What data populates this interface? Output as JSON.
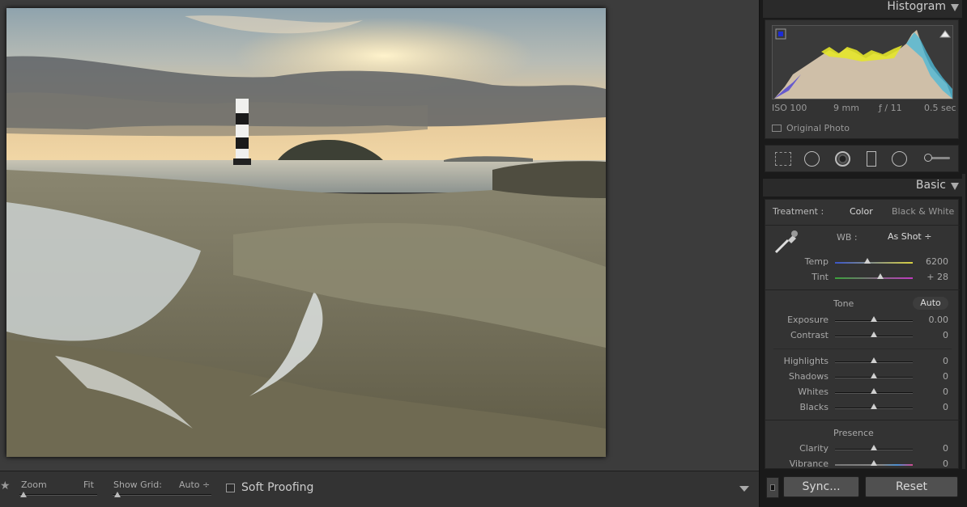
{
  "toolbar": {
    "zoom_label": "Zoom",
    "zoom_value": "Fit",
    "grid_label": "Show Grid:",
    "grid_value": "Auto ÷",
    "soft_proofing_label": "Soft Proofing"
  },
  "histogram": {
    "title": "Histogram",
    "iso": "ISO 100",
    "focal": "9 mm",
    "aperture": "ƒ / 11",
    "shutter": "0.5 sec",
    "original_photo_label": "Original Photo"
  },
  "tools": [
    "crop-overlay-icon",
    "spot-removal-icon",
    "red-eye-icon",
    "graduated-filter-icon",
    "radial-filter-icon",
    "adjustment-brush-icon"
  ],
  "basic": {
    "title": "Basic",
    "treatment_label": "Treatment :",
    "treatment_color": "Color",
    "treatment_bw": "Black & White",
    "wb_label": "WB :",
    "wb_value": "As Shot ÷",
    "temp": {
      "label": "Temp",
      "value": "6200",
      "pos": 0.42
    },
    "tint": {
      "label": "Tint",
      "value": "+ 28",
      "pos": 0.58
    },
    "tone_label": "Tone",
    "auto_label": "Auto",
    "exposure": {
      "label": "Exposure",
      "value": "0.00",
      "pos": 0.5
    },
    "contrast": {
      "label": "Contrast",
      "value": "0",
      "pos": 0.5
    },
    "highlights": {
      "label": "Highlights",
      "value": "0",
      "pos": 0.5
    },
    "shadows": {
      "label": "Shadows",
      "value": "0",
      "pos": 0.5
    },
    "whites": {
      "label": "Whites",
      "value": "0",
      "pos": 0.5
    },
    "blacks": {
      "label": "Blacks",
      "value": "0",
      "pos": 0.5
    },
    "presence_label": "Presence",
    "clarity": {
      "label": "Clarity",
      "value": "0",
      "pos": 0.5
    },
    "vibrance": {
      "label": "Vibrance",
      "value": "0",
      "pos": 0.5
    }
  },
  "buttons": {
    "sync": "Sync...",
    "reset": "Reset"
  },
  "colors": {
    "panel_bg": "#333333",
    "workspace_bg": "#3c3c3c"
  }
}
